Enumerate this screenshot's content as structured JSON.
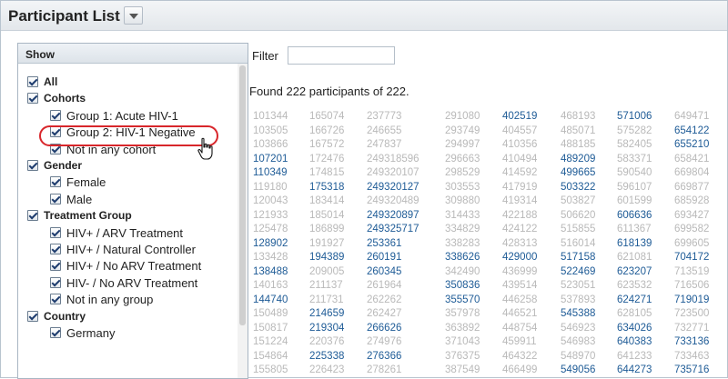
{
  "title": "Participant List",
  "show_panel": {
    "header": "Show",
    "rows": [
      {
        "label": "All",
        "bold": true,
        "indent": 0
      },
      {
        "label": "Cohorts",
        "bold": true,
        "indent": 0
      },
      {
        "label": "Group 1: Acute HIV-1",
        "bold": false,
        "indent": 1
      },
      {
        "label": "Group 2: HIV-1 Negative",
        "bold": false,
        "indent": 1
      },
      {
        "label": "Not in any cohort",
        "bold": false,
        "indent": 1
      },
      {
        "label": "Gender",
        "bold": true,
        "indent": 0
      },
      {
        "label": "Female",
        "bold": false,
        "indent": 1
      },
      {
        "label": "Male",
        "bold": false,
        "indent": 1
      },
      {
        "label": "Treatment Group",
        "bold": true,
        "indent": 0
      },
      {
        "label": "HIV+ / ARV Treatment",
        "bold": false,
        "indent": 1
      },
      {
        "label": "HIV+ / Natural Controller",
        "bold": false,
        "indent": 1
      },
      {
        "label": "HIV+ / No ARV Treatment",
        "bold": false,
        "indent": 1
      },
      {
        "label": "HIV- / No ARV Treatment",
        "bold": false,
        "indent": 1
      },
      {
        "label": "Not in any group",
        "bold": false,
        "indent": 1
      },
      {
        "label": "Country",
        "bold": true,
        "indent": 0
      },
      {
        "label": "Germany",
        "bold": false,
        "indent": 1
      }
    ]
  },
  "filter": {
    "label": "Filter",
    "value": ""
  },
  "found_text": "Found 222 participants of 222.",
  "participant_columns": [
    [
      {
        "id": "101344",
        "a": 0
      },
      {
        "id": "103505",
        "a": 0
      },
      {
        "id": "103866",
        "a": 0
      },
      {
        "id": "107201",
        "a": 1
      },
      {
        "id": "110349",
        "a": 1
      },
      {
        "id": "119180",
        "a": 0
      },
      {
        "id": "120043",
        "a": 0
      },
      {
        "id": "121933",
        "a": 0
      },
      {
        "id": "125478",
        "a": 0
      },
      {
        "id": "128902",
        "a": 1
      },
      {
        "id": "133428",
        "a": 0
      },
      {
        "id": "138488",
        "a": 1
      },
      {
        "id": "140163",
        "a": 0
      },
      {
        "id": "144740",
        "a": 1
      },
      {
        "id": "150489",
        "a": 0
      },
      {
        "id": "150817",
        "a": 0
      },
      {
        "id": "151224",
        "a": 0
      },
      {
        "id": "154864",
        "a": 0
      },
      {
        "id": "155805",
        "a": 0
      }
    ],
    [
      {
        "id": "165074",
        "a": 0
      },
      {
        "id": "166726",
        "a": 0
      },
      {
        "id": "167572",
        "a": 0
      },
      {
        "id": "172476",
        "a": 0
      },
      {
        "id": "174815",
        "a": 0
      },
      {
        "id": "175318",
        "a": 1
      },
      {
        "id": "183414",
        "a": 0
      },
      {
        "id": "185014",
        "a": 0
      },
      {
        "id": "186899",
        "a": 0
      },
      {
        "id": "191927",
        "a": 0
      },
      {
        "id": "194389",
        "a": 1
      },
      {
        "id": "209005",
        "a": 0
      },
      {
        "id": "211137",
        "a": 0
      },
      {
        "id": "211731",
        "a": 0
      },
      {
        "id": "214659",
        "a": 1
      },
      {
        "id": "219304",
        "a": 1
      },
      {
        "id": "220376",
        "a": 0
      },
      {
        "id": "225338",
        "a": 1
      },
      {
        "id": "226423",
        "a": 0
      }
    ],
    [
      {
        "id": "237773",
        "a": 0
      },
      {
        "id": "246655",
        "a": 0
      },
      {
        "id": "247837",
        "a": 0
      },
      {
        "id": "249318596",
        "a": 0
      },
      {
        "id": "249320107",
        "a": 0
      },
      {
        "id": "249320127",
        "a": 1
      },
      {
        "id": "249320489",
        "a": 0
      },
      {
        "id": "249320897",
        "a": 1
      },
      {
        "id": "249325717",
        "a": 1
      },
      {
        "id": "253361",
        "a": 1
      },
      {
        "id": "260191",
        "a": 1
      },
      {
        "id": "260345",
        "a": 1
      },
      {
        "id": "261964",
        "a": 0
      },
      {
        "id": "262262",
        "a": 0
      },
      {
        "id": "262427",
        "a": 0
      },
      {
        "id": "266626",
        "a": 1
      },
      {
        "id": "274976",
        "a": 0
      },
      {
        "id": "276366",
        "a": 1
      },
      {
        "id": "278261",
        "a": 0
      }
    ],
    [
      {
        "id": "291080",
        "a": 0
      },
      {
        "id": "293749",
        "a": 0
      },
      {
        "id": "294997",
        "a": 0
      },
      {
        "id": "296663",
        "a": 0
      },
      {
        "id": "298529",
        "a": 0
      },
      {
        "id": "303553",
        "a": 0
      },
      {
        "id": "309880",
        "a": 0
      },
      {
        "id": "314433",
        "a": 0
      },
      {
        "id": "334829",
        "a": 0
      },
      {
        "id": "338283",
        "a": 0
      },
      {
        "id": "338626",
        "a": 1
      },
      {
        "id": "342490",
        "a": 0
      },
      {
        "id": "350836",
        "a": 1
      },
      {
        "id": "355570",
        "a": 1
      },
      {
        "id": "357978",
        "a": 0
      },
      {
        "id": "363892",
        "a": 0
      },
      {
        "id": "371043",
        "a": 0
      },
      {
        "id": "376375",
        "a": 0
      },
      {
        "id": "387549",
        "a": 0
      }
    ],
    [
      {
        "id": "402519",
        "a": 1
      },
      {
        "id": "404557",
        "a": 0
      },
      {
        "id": "410356",
        "a": 0
      },
      {
        "id": "410494",
        "a": 0
      },
      {
        "id": "414592",
        "a": 0
      },
      {
        "id": "417919",
        "a": 0
      },
      {
        "id": "419314",
        "a": 0
      },
      {
        "id": "422188",
        "a": 0
      },
      {
        "id": "424122",
        "a": 0
      },
      {
        "id": "428313",
        "a": 0
      },
      {
        "id": "429000",
        "a": 1
      },
      {
        "id": "436999",
        "a": 0
      },
      {
        "id": "439514",
        "a": 0
      },
      {
        "id": "446258",
        "a": 0
      },
      {
        "id": "446521",
        "a": 0
      },
      {
        "id": "448754",
        "a": 0
      },
      {
        "id": "459911",
        "a": 0
      },
      {
        "id": "464322",
        "a": 0
      },
      {
        "id": "466499",
        "a": 0
      }
    ],
    [
      {
        "id": "468193",
        "a": 0
      },
      {
        "id": "485071",
        "a": 0
      },
      {
        "id": "488185",
        "a": 0
      },
      {
        "id": "489209",
        "a": 1
      },
      {
        "id": "499665",
        "a": 1
      },
      {
        "id": "503322",
        "a": 1
      },
      {
        "id": "503827",
        "a": 0
      },
      {
        "id": "506620",
        "a": 0
      },
      {
        "id": "515855",
        "a": 0
      },
      {
        "id": "516014",
        "a": 0
      },
      {
        "id": "517158",
        "a": 1
      },
      {
        "id": "522469",
        "a": 1
      },
      {
        "id": "523051",
        "a": 0
      },
      {
        "id": "537893",
        "a": 0
      },
      {
        "id": "545388",
        "a": 1
      },
      {
        "id": "546923",
        "a": 0
      },
      {
        "id": "546983",
        "a": 0
      },
      {
        "id": "548970",
        "a": 0
      },
      {
        "id": "549056",
        "a": 1
      }
    ],
    [
      {
        "id": "571006",
        "a": 1
      },
      {
        "id": "575282",
        "a": 0
      },
      {
        "id": "582405",
        "a": 0
      },
      {
        "id": "583371",
        "a": 0
      },
      {
        "id": "590540",
        "a": 0
      },
      {
        "id": "596107",
        "a": 0
      },
      {
        "id": "601599",
        "a": 0
      },
      {
        "id": "606636",
        "a": 1
      },
      {
        "id": "611367",
        "a": 0
      },
      {
        "id": "618139",
        "a": 1
      },
      {
        "id": "621081",
        "a": 0
      },
      {
        "id": "623207",
        "a": 1
      },
      {
        "id": "623532",
        "a": 0
      },
      {
        "id": "624271",
        "a": 1
      },
      {
        "id": "628105",
        "a": 0
      },
      {
        "id": "634026",
        "a": 1
      },
      {
        "id": "640383",
        "a": 1
      },
      {
        "id": "641233",
        "a": 0
      },
      {
        "id": "644273",
        "a": 1
      }
    ],
    [
      {
        "id": "649471",
        "a": 0
      },
      {
        "id": "654122",
        "a": 1
      },
      {
        "id": "655210",
        "a": 1
      },
      {
        "id": "658421",
        "a": 0
      },
      {
        "id": "669804",
        "a": 0
      },
      {
        "id": "669877",
        "a": 0
      },
      {
        "id": "685928",
        "a": 0
      },
      {
        "id": "693427",
        "a": 0
      },
      {
        "id": "699582",
        "a": 0
      },
      {
        "id": "699605",
        "a": 0
      },
      {
        "id": "704172",
        "a": 1
      },
      {
        "id": "713519",
        "a": 0
      },
      {
        "id": "716506",
        "a": 0
      },
      {
        "id": "719019",
        "a": 1
      },
      {
        "id": "723500",
        "a": 0
      },
      {
        "id": "732771",
        "a": 0
      },
      {
        "id": "733136",
        "a": 1
      },
      {
        "id": "733463",
        "a": 0
      },
      {
        "id": "735716",
        "a": 1
      }
    ]
  ],
  "colors": {
    "active": "#1e5b96",
    "inactive": "#b9b9b9",
    "highlight": "#d8262b"
  },
  "icons": {
    "menu": "chevron-down-icon",
    "checkbox": "checkbox-checked-icon",
    "cursor": "hand-pointer-icon"
  }
}
